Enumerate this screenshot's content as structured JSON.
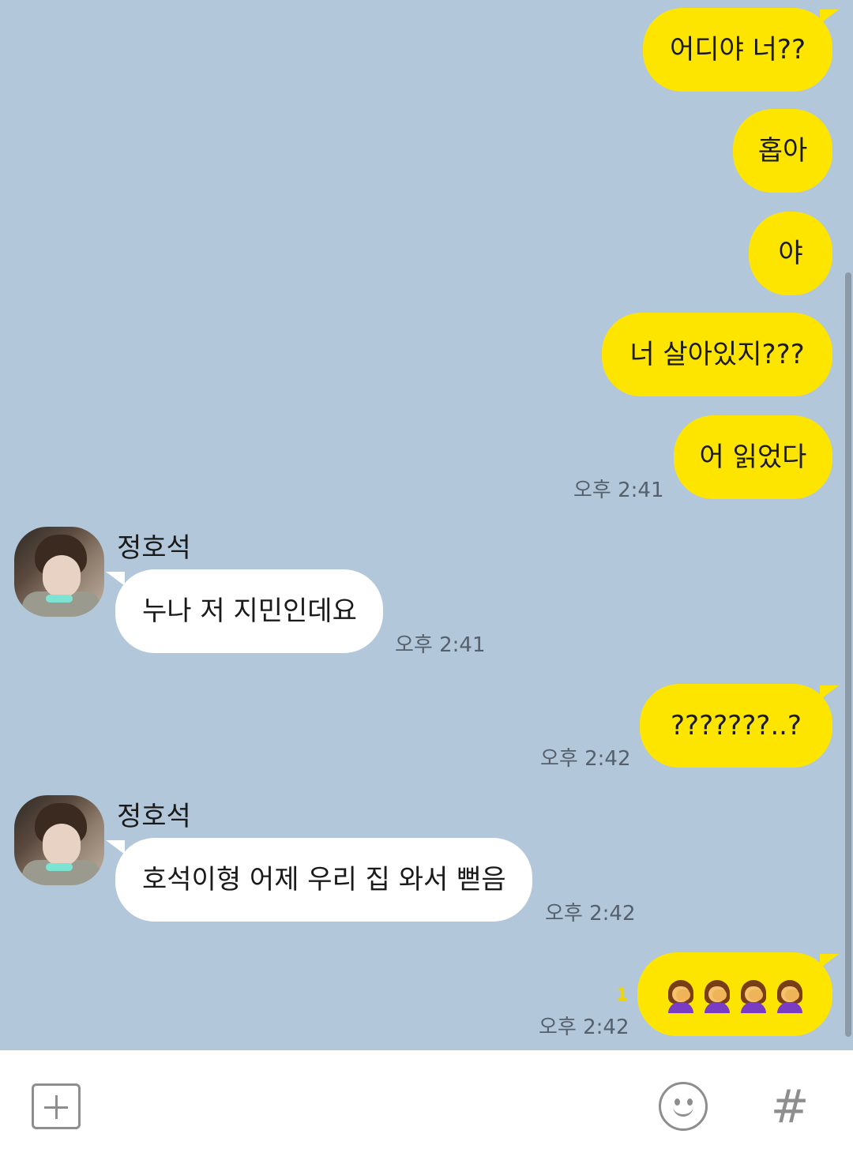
{
  "theme": {
    "background": "#b2c7da",
    "my_bubble": "#fee500",
    "their_bubble": "#ffffff"
  },
  "messages": [
    {
      "sender": "me",
      "text": "어디야 너??"
    },
    {
      "sender": "me",
      "text": "홉아"
    },
    {
      "sender": "me",
      "text": "야"
    },
    {
      "sender": "me",
      "text": "너 살아있지???"
    },
    {
      "sender": "me",
      "text": "어 읽었다",
      "time": "오후 2:41"
    },
    {
      "sender": "other",
      "name": "정호석",
      "text": "누나 저 지민인데요",
      "time": "오후 2:41"
    },
    {
      "sender": "me",
      "text": "???????..?",
      "time": "오후 2:42"
    },
    {
      "sender": "other",
      "name": "정호석",
      "text": "호석이형 어제 우리 집 와서 뻗음",
      "time": "오후 2:42"
    },
    {
      "sender": "me",
      "emoji": "woman-facepalming-emoji",
      "emoji_count": 4,
      "unread": "1",
      "time": "오후 2:42"
    }
  ],
  "input_bar": {
    "plus_icon": "plus-square-icon",
    "emoticon_icon": "smiley-icon",
    "hashtag_icon": "hashtag-icon",
    "hashtag_glyph": "#"
  }
}
